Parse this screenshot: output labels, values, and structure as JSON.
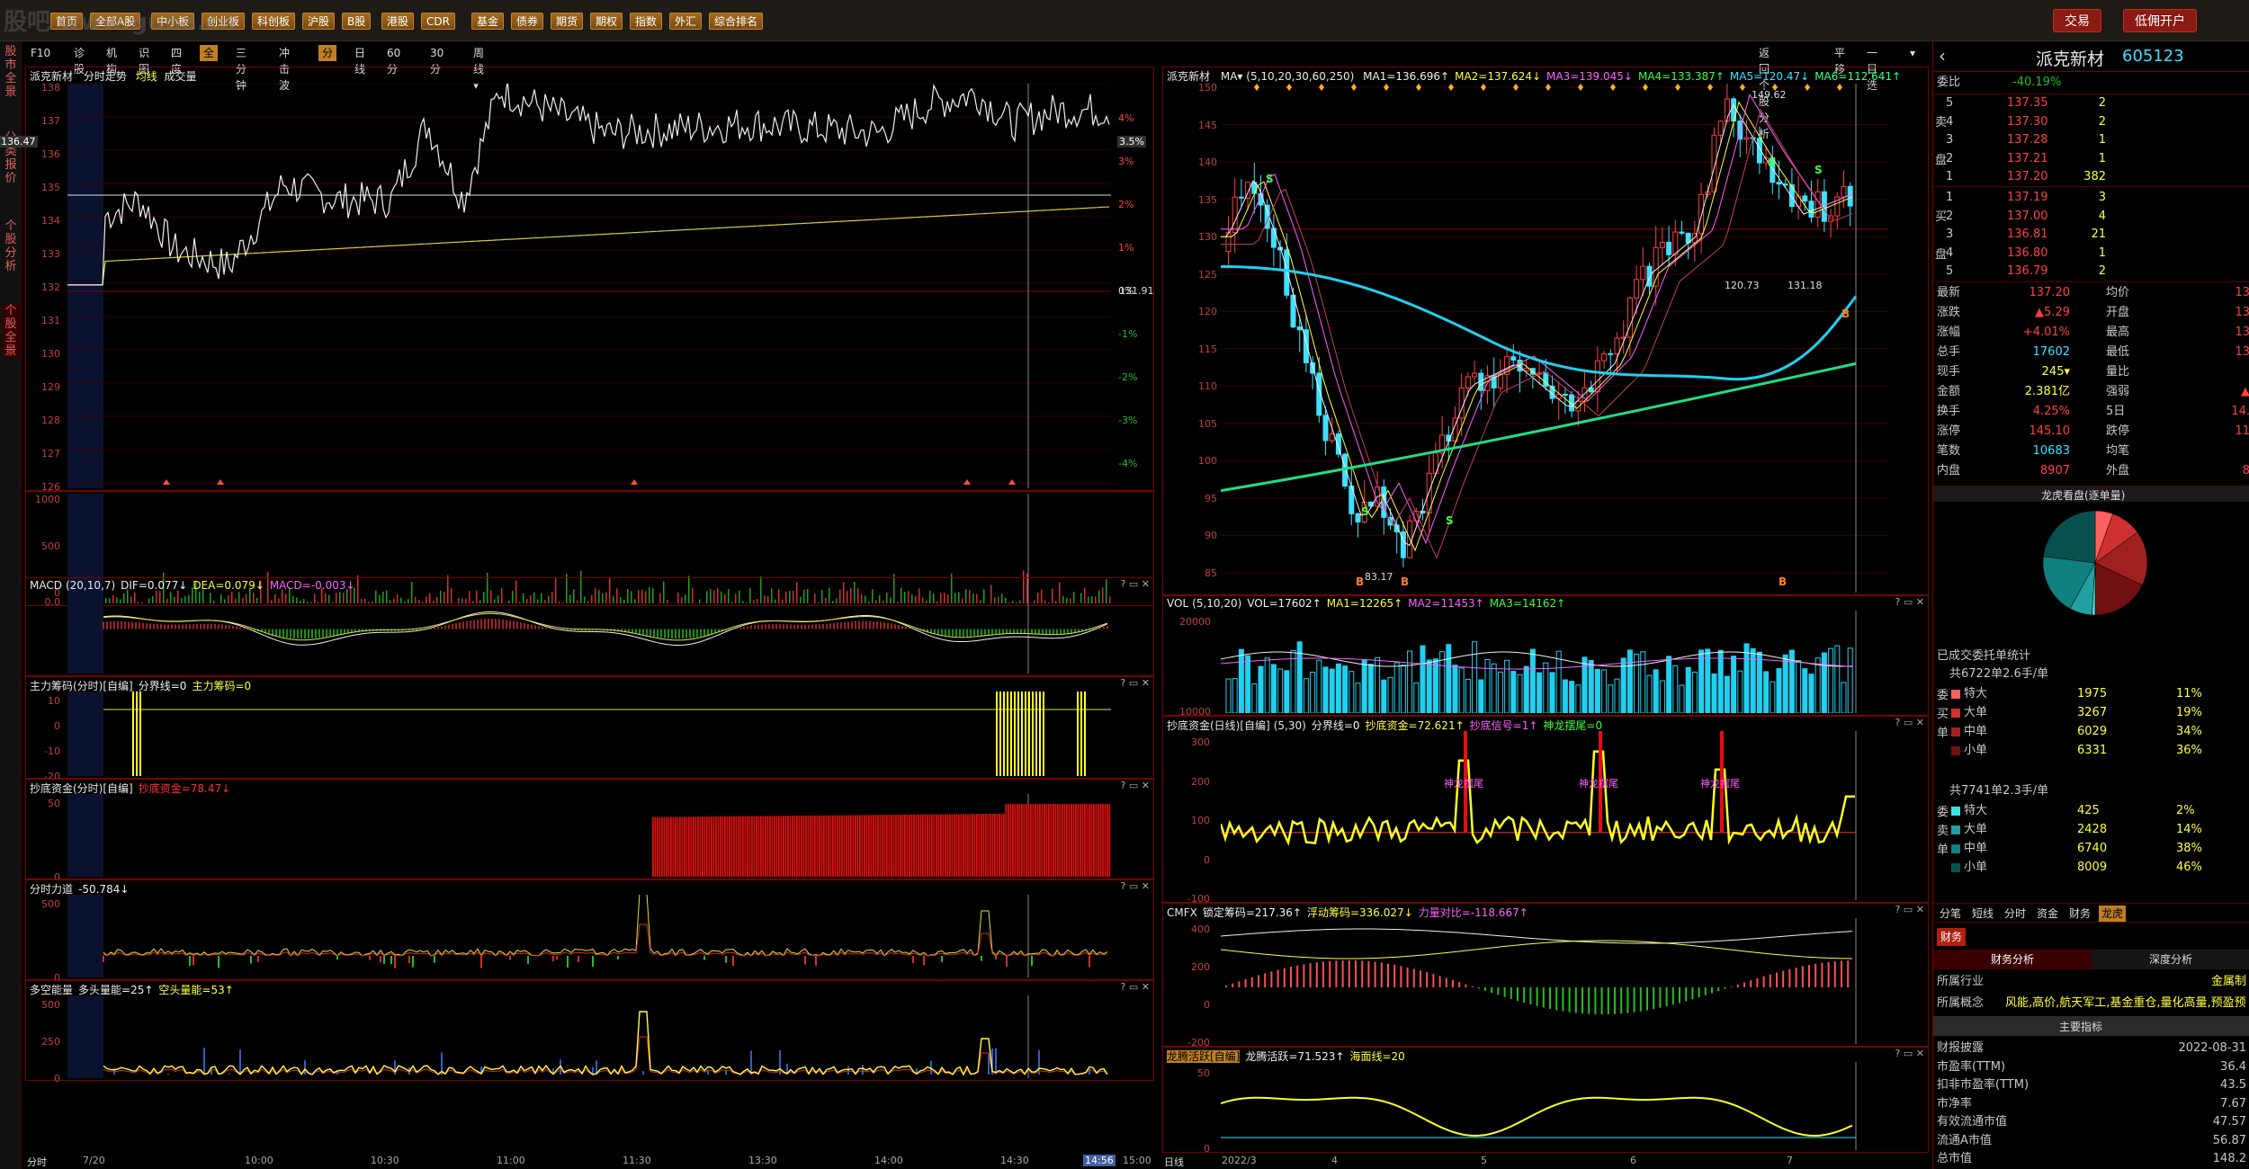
{
  "toolbar": {
    "buttons": [
      "首页",
      "全部A股",
      "中小板",
      "创业板",
      "科创板",
      "沪股",
      "B股",
      "港股",
      "CDR",
      "基金",
      "债券",
      "期货",
      "期权",
      "指数",
      "外汇",
      "综合排名"
    ],
    "trade": "交易",
    "open_account": "低佣开户",
    "watermark": "股吧 www.guba.cn"
  },
  "sidebar": {
    "tabs": [
      "股市全景",
      "分类报价",
      "个股分析",
      "个股全景"
    ]
  },
  "sub_toolbar": {
    "left": [
      "F10",
      "诊股",
      "机构",
      "识图",
      "四度",
      "全景",
      "三分钟",
      "冲击波"
    ],
    "mid": [
      "分时",
      "日线",
      "60分",
      "30分",
      "周线▾"
    ],
    "right": [
      "返回个股分析",
      "平移",
      "一目选",
      "▾"
    ]
  },
  "intraday": {
    "title": "派克新材",
    "mode": "分时走势",
    "legend": [
      "均线",
      "成交量"
    ],
    "price_label": "136.47",
    "right_label": "3.5%",
    "base_price": "131.91",
    "y_left": [
      "138",
      "137",
      "136",
      "135",
      "134",
      "133",
      "132",
      "131",
      "130",
      "129",
      "128",
      "127",
      "126"
    ],
    "y_right": [
      "4%",
      "3%",
      "2%",
      "1%",
      "0%",
      "-1%",
      "-2%",
      "-3%",
      "-4%"
    ],
    "vol_axis": [
      "1000",
      "500",
      "0"
    ],
    "x_axis": [
      "7/20",
      "10:00",
      "10:30",
      "11:00",
      "11:30",
      "13:30",
      "14:00",
      "14:30",
      "14:56",
      "15:00"
    ],
    "x_start": "分时",
    "panels": [
      {
        "title": "MACD",
        "params": "(20,10,7)",
        "values": [
          "DIF=0.077↓",
          "DEA=0.079↓",
          "MACD=-0.003↓"
        ],
        "axis": [
          "0.0"
        ]
      },
      {
        "title": "主力筹码(分时)[自编]",
        "values": [
          "分界线=0",
          "主力筹码=0"
        ],
        "axis": [
          "10",
          "0",
          "-10",
          "-20"
        ]
      },
      {
        "title": "抄底资金(分时)[自编]",
        "values": [
          "抄底资金=78.47↓"
        ],
        "axis": [
          "50",
          "0"
        ]
      },
      {
        "title": "分时力道",
        "values": [
          "-50.784↓"
        ],
        "axis": [
          "500",
          "0"
        ]
      },
      {
        "title": "多空能量",
        "values": [
          "多头量能=25↑",
          "空头量能=53↑"
        ],
        "axis": [
          "500",
          "250",
          "0"
        ]
      }
    ]
  },
  "daily": {
    "title": "派克新材",
    "ma_label": "MA▾",
    "ma_params": "(5,10,20,30,60,250)",
    "ma_values": [
      "MA1=136.696↑",
      "MA2=137.624↓",
      "MA3=139.045↓",
      "MA4=133.387↑",
      "MA5=120.47↓",
      "MA6=112.641↑"
    ],
    "y_axis": [
      "150",
      "145",
      "140",
      "135",
      "130",
      "125",
      "120",
      "115",
      "110",
      "105",
      "100",
      "95",
      "90",
      "85"
    ],
    "annotations": [
      "149.62",
      "120.73",
      "131.18",
      "83.17"
    ],
    "signals": [
      "S",
      "S",
      "S",
      "S",
      "S",
      "B",
      "B",
      "B",
      "B"
    ],
    "x_axis": [
      "2022/3",
      "4",
      "5",
      "6",
      "7"
    ],
    "x_start": "日线",
    "panels": [
      {
        "title": "VOL",
        "params": "(5,10,20)",
        "values": [
          "VOL=17602↑",
          "MA1=12265↑",
          "MA2=11453↑",
          "MA3=14162↑"
        ],
        "axis": [
          "20000",
          "10000"
        ]
      },
      {
        "title": "抄底资金(日线)[自编]",
        "params": "(5,30)",
        "values": [
          "分界线=0",
          "抄底资金=72.621↑",
          "抄底信号=1↑",
          "神龙摆尾=0"
        ],
        "axis": [
          "300",
          "200",
          "100",
          "0",
          "-100"
        ],
        "tags": [
          "神龙摆尾",
          "神龙摆尾",
          "神龙摆尾"
        ]
      },
      {
        "title": "CMFX",
        "values": [
          "锁定筹码=217.36↑",
          "浮动筹码=336.027↓",
          "力量对比=-118.667↑"
        ],
        "axis": [
          "400",
          "200",
          "0",
          "-200"
        ]
      },
      {
        "title": "龙腾活跃[自编]",
        "values": [
          "龙腾活跃=71.523↑",
          "海面线=20"
        ],
        "axis": [
          "50",
          "0"
        ]
      }
    ]
  },
  "quote": {
    "name": "派克新材",
    "code": "605123",
    "wei_bi_label": "委比",
    "wei_bi": "-40.19%",
    "asks": [
      {
        "label": "5",
        "price": "137.35",
        "vol": "2"
      },
      {
        "label": "4",
        "price": "137.30",
        "vol": "2"
      },
      {
        "label": "3",
        "price": "137.28",
        "vol": "1"
      },
      {
        "label": "2",
        "price": "137.21",
        "vol": "1"
      },
      {
        "label": "1",
        "price": "137.20",
        "vol": "382"
      }
    ],
    "ask_side": [
      "卖",
      "盘"
    ],
    "bids": [
      {
        "label": "1",
        "price": "137.19",
        "vol": "3"
      },
      {
        "label": "2",
        "price": "137.00",
        "vol": "4"
      },
      {
        "label": "3",
        "price": "136.81",
        "vol": "21"
      },
      {
        "label": "4",
        "price": "136.80",
        "vol": "1"
      },
      {
        "label": "5",
        "price": "136.79",
        "vol": "2"
      }
    ],
    "bid_side": [
      "买",
      "盘"
    ],
    "stats": [
      {
        "k": "最新",
        "v": "137.20",
        "k2": "均价",
        "v2": "13"
      },
      {
        "k": "涨跌",
        "v": "▲5.29",
        "k2": "开盘",
        "v2": "13"
      },
      {
        "k": "涨幅",
        "v": "+4.01%",
        "k2": "最高",
        "v2": "13"
      },
      {
        "k": "总手",
        "v": "17602",
        "k2": "最低",
        "v2": "13"
      },
      {
        "k": "现手",
        "v": "245▾",
        "k2": "量比",
        "v2": ""
      },
      {
        "k": "金额",
        "v": "2.381亿",
        "k2": "强弱",
        "v2": "▲"
      },
      {
        "k": "换手",
        "v": "4.25%",
        "k2": "5日",
        "v2": "14."
      },
      {
        "k": "涨停",
        "v": "145.10",
        "k2": "跌停",
        "v2": "11"
      },
      {
        "k": "笔数",
        "v": "10683",
        "k2": "均笔",
        "v2": ""
      },
      {
        "k": "内盘",
        "v": "8907",
        "k2": "外盘",
        "v2": "8"
      }
    ],
    "pie_title": "龙虎看盘(逐单量)",
    "order_title": "已成交委托单统计",
    "buy_total": "共6722单2.6手/单",
    "buy_side": [
      "委",
      "买",
      "单"
    ],
    "buy_rows": [
      {
        "color": "#ff6060",
        "name": "特大",
        "num": "1975",
        "pct": "11%"
      },
      {
        "color": "#d03030",
        "name": "大单",
        "num": "3267",
        "pct": "19%"
      },
      {
        "color": "#a02020",
        "name": "中单",
        "num": "6029",
        "pct": "34%"
      },
      {
        "color": "#701010",
        "name": "小单",
        "num": "6331",
        "pct": "36%"
      }
    ],
    "sell_total": "共7741单2.3手/单",
    "sell_side": [
      "委",
      "卖",
      "单"
    ],
    "sell_rows": [
      {
        "color": "#40e0e0",
        "name": "特大",
        "num": "425",
        "pct": "2%"
      },
      {
        "color": "#20a0a0",
        "name": "大单",
        "num": "2428",
        "pct": "14%"
      },
      {
        "color": "#108080",
        "name": "中单",
        "num": "6740",
        "pct": "38%"
      },
      {
        "color": "#085050",
        "name": "小单",
        "num": "8009",
        "pct": "46%"
      }
    ],
    "tabs": [
      "分笔",
      "短线",
      "分时",
      "资金",
      "财务",
      "龙虎"
    ],
    "fin_tab": "财务",
    "fin_sub": [
      "财务分析",
      "深度分析"
    ],
    "industry_label": "所属行业",
    "industry": "金属制",
    "concept_label": "所属概念",
    "concept": "风能,高价,航天军工,基金重仓,量化高量,预盈预",
    "main_index": "主要指标",
    "fin_rows": [
      {
        "k": "财报披露",
        "v": "2022-08-31"
      },
      {
        "k": "市盈率(TTM)",
        "v": "36.4"
      },
      {
        "k": "扣非市盈率(TTM)",
        "v": "43.5"
      },
      {
        "k": "市净率",
        "v": "7.67"
      },
      {
        "k": "有效流通市值",
        "v": "47.57"
      },
      {
        "k": "流通A市值",
        "v": "56.87"
      },
      {
        "k": "总市值",
        "v": "148.2"
      }
    ]
  }
}
